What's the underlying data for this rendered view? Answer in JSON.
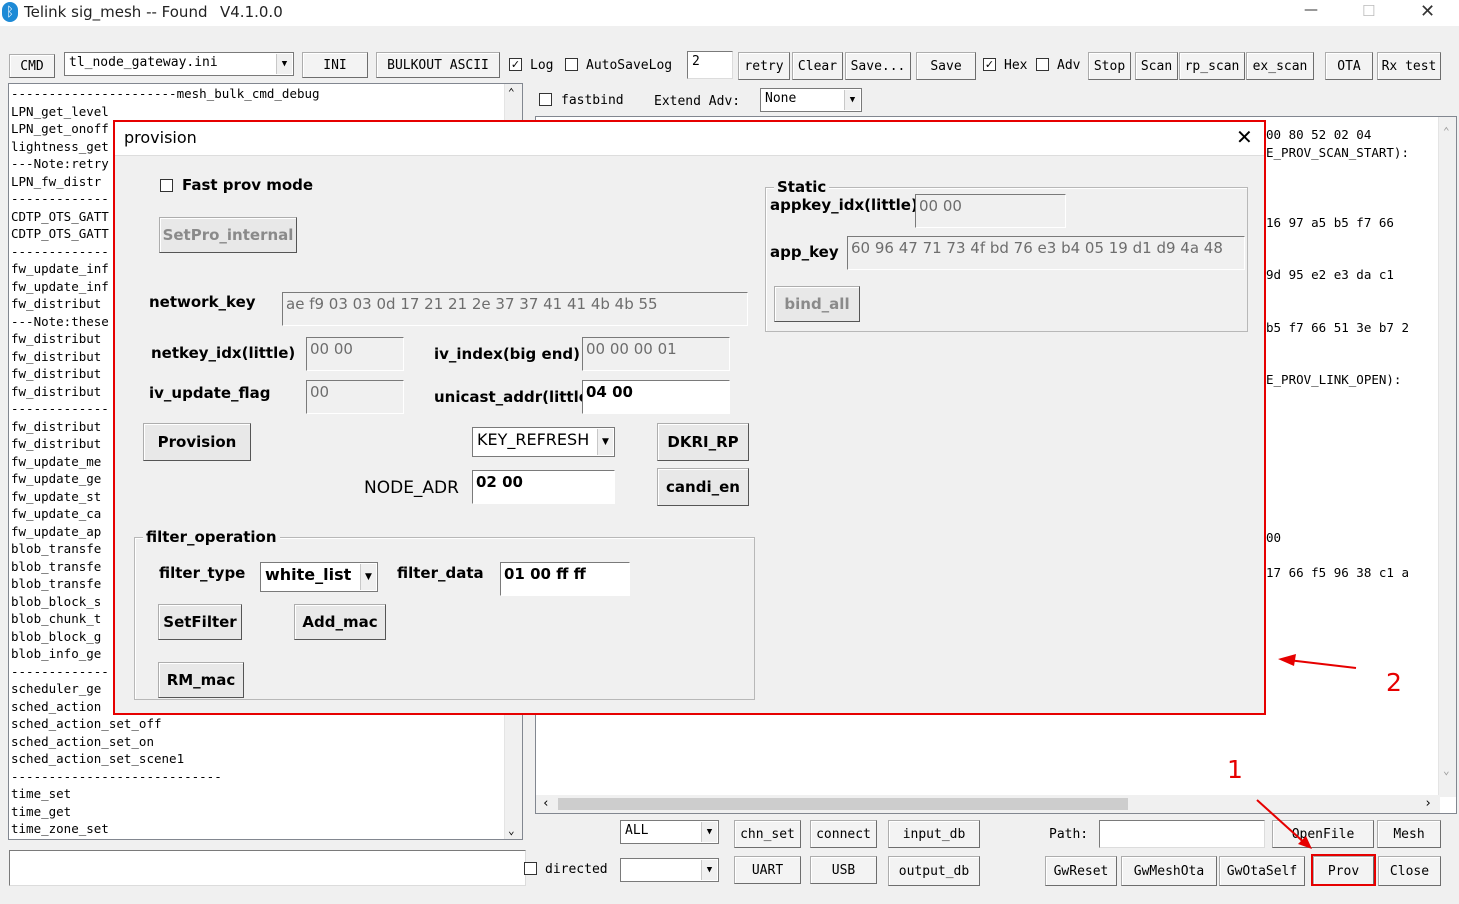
{
  "window": {
    "title": "Telink sig_mesh -- Found",
    "version": "V4.1.0.0",
    "controls": {
      "minimize": "—",
      "maximize": "☐",
      "close": "✕"
    }
  },
  "toolbar": {
    "cmd": "CMD",
    "ini_file": "tl_node_gateway.ini",
    "ini": "INI",
    "bulkout": "BULKOUT ASCII",
    "log": "Log",
    "autosave": "AutoSaveLog",
    "retry_value": "2",
    "retry": "retry",
    "clear": "Clear",
    "save_dots": "Save...",
    "save": "Save",
    "hex": "Hex",
    "adv": "Adv",
    "stop": "Stop",
    "scan": "Scan",
    "rp_scan": "rp_scan",
    "ex_scan": "ex_scan",
    "ota": "OTA",
    "rx_test": "Rx test",
    "fastbind": "fastbind",
    "extend_adv": "Extend Adv:",
    "extend_adv_value": "None"
  },
  "cmd_list": [
    "----------------------mesh_bulk_cmd_debug",
    "LPN_get_level",
    "LPN_get_onoff",
    "lightness_get",
    "---Note:retry",
    "LPN_fw_distr",
    "-------------",
    "CDTP_OTS_GATT",
    "CDTP_OTS_GATT",
    "-------------",
    "fw_update_inf",
    "fw_update_inf",
    "fw_distribut",
    "---Note:these",
    "fw_distribut",
    "fw_distribut",
    "fw_distribut",
    "fw_distribut",
    "-------------",
    "fw_distribut",
    "fw_distribut",
    "fw_update_me",
    "fw_update_ge",
    "fw_update_st",
    "fw_update_ca",
    "fw_update_ap",
    "blob_transfe",
    "blob_transfe",
    "blob_transfe",
    "blob_block_s",
    "blob_chunk_t",
    "blob_block_g",
    "blob_info_ge",
    "-------------",
    "scheduler_ge",
    "sched_action",
    "sched_action_set_off",
    "sched_action_set_on",
    "sched_action_set_scene1",
    "----------------------------",
    "time_set",
    "time_get",
    "time_zone_set"
  ],
  "log_lines": [
    {
      "text": "00 80 52 02 04",
      "row": 0
    },
    {
      "text": "E_PROV_SCAN_START):",
      "row": 1
    },
    {
      "text": "16 97 a5 b5 f7 66",
      "row": 5
    },
    {
      "text": "9d 95 e2 e3 da c1",
      "row": 8
    },
    {
      "text": "b5 f7 66 51 3e b7 2",
      "row": 11
    },
    {
      "text": "E_PROV_LINK_OPEN):",
      "row": 14
    },
    {
      "text": "00",
      "row": 23
    },
    {
      "text": "17 66 f5 96 38 c1 a",
      "row": 25
    }
  ],
  "bottom": {
    "all": "ALL",
    "chn_set": "chn_set",
    "connect": "connect",
    "input_db": "input_db",
    "path": "Path:",
    "openfile": "OpenFile",
    "mesh": "Mesh",
    "directed": "directed",
    "uart": "UART",
    "usb": "USB",
    "output_db": "output_db",
    "gwreset": "GwReset",
    "gwmeshota": "GwMeshOta",
    "gwotaself": "GwOtaSelf",
    "prov": "Prov",
    "close": "Close"
  },
  "annotations": {
    "one": "1",
    "two": "2"
  },
  "dialog": {
    "title": "provision",
    "fast_prov": "Fast prov mode",
    "setpro_internal": "SetPro_internal",
    "network_key_label": "network_key",
    "network_key": "ae f9 03 03 0d 17 21 21 2e 37 37 41 41 4b 4b 55",
    "netkey_idx_label": "netkey_idx(little)",
    "netkey_idx": "00 00",
    "iv_index_label": "iv_index(big end)",
    "iv_index": "00 00 00 01",
    "iv_update_flag_label": "iv_update_flag",
    "iv_update_flag": "00",
    "unicast_addr_label": "unicast_addr(little)",
    "unicast_addr": "04 00",
    "provision": "Provision",
    "key_refresh": "KEY_REFRESH",
    "dkri_rp": "DKRI_RP",
    "node_adr_label": "NODE_ADR",
    "node_adr": "02 00",
    "candi_en": "candi_en",
    "static": {
      "title": "Static",
      "appkey_idx_label": "appkey_idx(little)",
      "appkey_idx": "00 00",
      "app_key_label": "app_key",
      "app_key": "60 96 47 71 73 4f bd 76 e3 b4 05 19 d1 d9 4a 48",
      "bind_all": "bind_all"
    },
    "filter": {
      "title": "filter_operation",
      "filter_type_label": "filter_type",
      "filter_type": "white_list",
      "filter_data_label": "filter_data",
      "filter_data": "01 00 ff ff",
      "setfilter": "SetFilter",
      "add_mac": "Add_mac",
      "rm_mac": "RM_mac"
    }
  }
}
